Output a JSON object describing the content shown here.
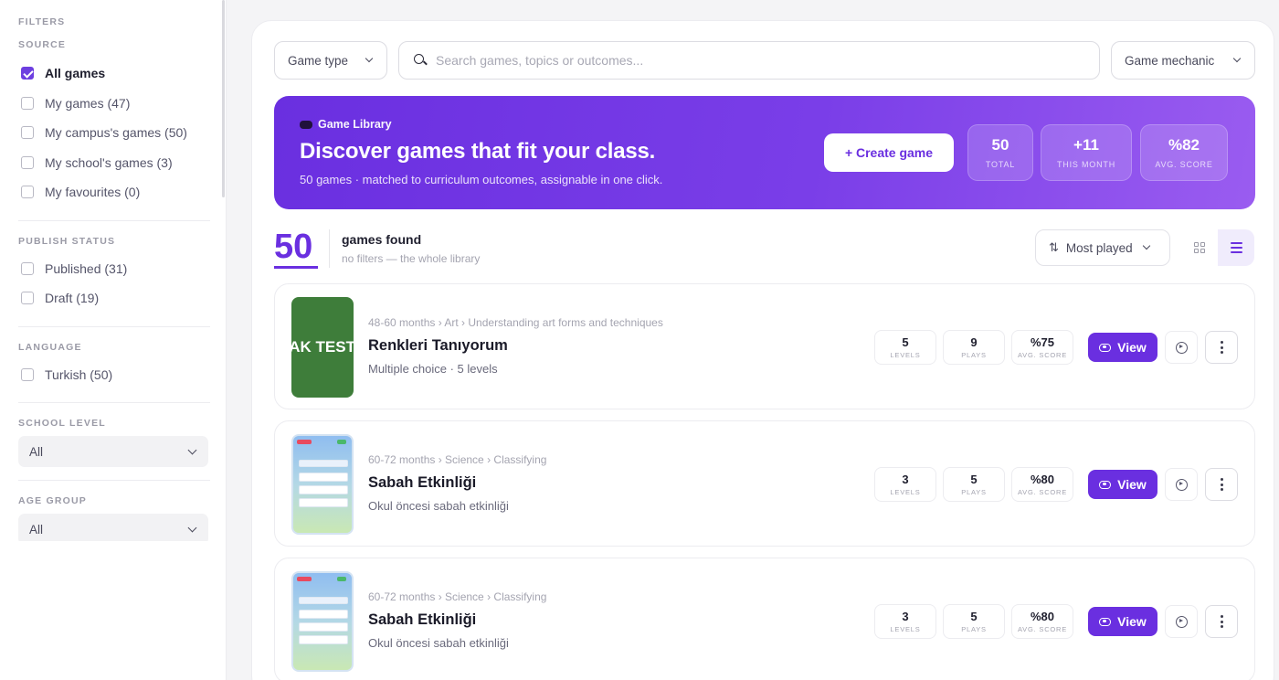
{
  "sidebar": {
    "filters_label": "FILTERS",
    "source": {
      "label": "SOURCE",
      "items": [
        {
          "label": "All games",
          "checked": true
        },
        {
          "label": "My games (47)",
          "checked": false
        },
        {
          "label": "My campus's games (50)",
          "checked": false
        },
        {
          "label": "My school's games (3)",
          "checked": false
        },
        {
          "label": "My favourites (0)",
          "checked": false
        }
      ]
    },
    "publish_status": {
      "label": "PUBLISH STATUS",
      "items": [
        {
          "label": "Published (31)",
          "checked": false
        },
        {
          "label": "Draft (19)",
          "checked": false
        }
      ]
    },
    "language": {
      "label": "LANGUAGE",
      "items": [
        {
          "label": "Turkish (50)",
          "checked": false
        }
      ]
    },
    "school_level": {
      "label": "SCHOOL LEVEL",
      "value": "All"
    },
    "age_group": {
      "label": "AGE GROUP",
      "value": "All"
    }
  },
  "toolbar": {
    "game_type": "Game type",
    "search_placeholder": "Search games, topics or outcomes...",
    "game_mechanic": "Game mechanic"
  },
  "hero": {
    "eyebrow": "Game Library",
    "title": "Discover games that fit your class.",
    "subtitle": "50 games · matched to curriculum outcomes, assignable in one click.",
    "create_button": "+ Create game",
    "stats": [
      {
        "value": "50",
        "label": "TOTAL"
      },
      {
        "value": "+11",
        "label": "THIS MONTH"
      },
      {
        "value": "%82",
        "label": "AVG. SCORE"
      }
    ]
  },
  "results": {
    "count": "50",
    "title": "games found",
    "subtitle": "no filters — the whole library",
    "sort_label": "Most played"
  },
  "games": [
    {
      "thumb_text": "AK TEST",
      "path": "48-60 months › Art › Understanding art forms and techniques",
      "title": "Renkleri Tanıyorum",
      "desc": "Multiple choice · 5 levels",
      "stats": [
        {
          "value": "5",
          "label": "LEVELS"
        },
        {
          "value": "9",
          "label": "PLAYS"
        },
        {
          "value": "%75",
          "label": "AVG. SCORE"
        }
      ],
      "view_label": "View"
    },
    {
      "path": "60-72 months › Science › Classifying",
      "title": "Sabah Etkinliği",
      "desc": "Okul öncesi sabah etkinliği",
      "stats": [
        {
          "value": "3",
          "label": "LEVELS"
        },
        {
          "value": "5",
          "label": "PLAYS"
        },
        {
          "value": "%80",
          "label": "AVG. SCORE"
        }
      ],
      "view_label": "View"
    },
    {
      "path": "60-72 months › Science › Classifying",
      "title": "Sabah Etkinliği",
      "desc": "Okul öncesi sabah etkinliği",
      "stats": [
        {
          "value": "3",
          "label": "LEVELS"
        },
        {
          "value": "5",
          "label": "PLAYS"
        },
        {
          "value": "%80",
          "label": "AVG. SCORE"
        }
      ],
      "view_label": "View"
    }
  ],
  "colors": {
    "accent": "#6a2fe0",
    "hero_gradient_start": "#6a2fe0",
    "hero_gradient_end": "#9a5cf0",
    "thumb_green": "#3e7d3a"
  }
}
